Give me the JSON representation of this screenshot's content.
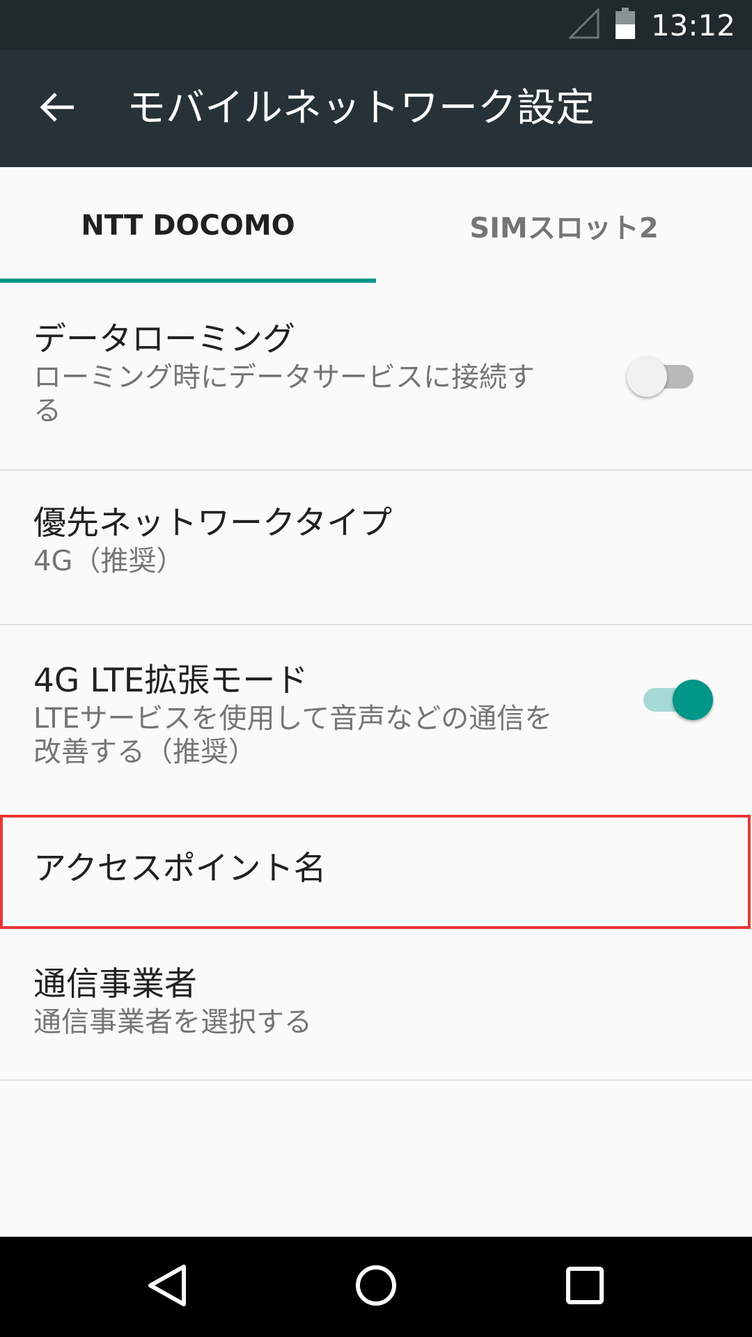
{
  "status_bar": {
    "time": "13:12",
    "icons": [
      "signal-icon",
      "battery-icon"
    ]
  },
  "toolbar": {
    "title": "モバイルネットワーク設定",
    "back_icon": "arrow-back-icon"
  },
  "tabs": [
    {
      "label": "NTT DOCOMO",
      "selected": true
    },
    {
      "label": "SIMスロット2",
      "selected": false
    }
  ],
  "items": {
    "data_roaming": {
      "title": "データローミング",
      "summary_line1": "ローミング時にデータサービスに接続す",
      "summary_line2": "る",
      "switch_on": false
    },
    "preferred_network": {
      "title": "優先ネットワークタイプ",
      "summary": "4G（推奨）"
    },
    "lte_mode": {
      "title": "4G LTE拡張モード",
      "summary_line1": "LTEサービスを使用して音声などの通信を",
      "summary_line2": "改善する（推奨）",
      "switch_on": true
    },
    "apn": {
      "title": "アクセスポイント名"
    },
    "carrier": {
      "title": "通信事業者",
      "summary": "通信事業者を選択する"
    }
  },
  "colors": {
    "accent": "#009688",
    "toolbar": "#263238",
    "status_bar": "#1f292e",
    "highlight": "#e53935"
  },
  "nav_bar": [
    "back-icon",
    "home-icon",
    "recents-icon"
  ]
}
